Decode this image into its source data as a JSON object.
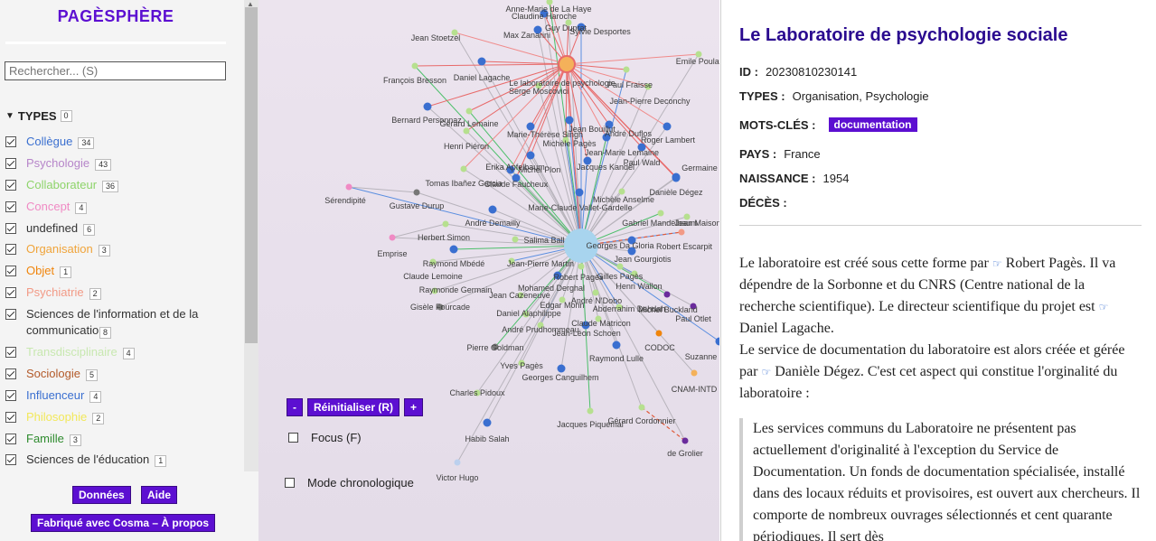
{
  "sidebar": {
    "title": "PAGÈSPHÈRE",
    "search_placeholder": "Rechercher... (S)",
    "types_heading": "TYPES",
    "types_count": "0",
    "types": [
      {
        "label": "Collègue",
        "count": "34",
        "color": "#3a6fd0"
      },
      {
        "label": "Psychologie",
        "count": "43",
        "color": "#b685c9"
      },
      {
        "label": "Collaborateur",
        "count": "36",
        "color": "#8ed46a"
      },
      {
        "label": "Concept",
        "count": "4",
        "color": "#f08ac4"
      },
      {
        "label": "undefined",
        "count": "6",
        "color": "#333333"
      },
      {
        "label": "Organisation",
        "count": "3",
        "color": "#f0a43a"
      },
      {
        "label": "Objet",
        "count": "1",
        "color": "#f0850c"
      },
      {
        "label": "Psychiatrie",
        "count": "2",
        "color": "#f29a86"
      },
      {
        "label": "Sciences de l'information et de la communication",
        "count": "8",
        "color": "#333333"
      },
      {
        "label": "Transdisciplinaire",
        "count": "4",
        "color": "#c8e8b0"
      },
      {
        "label": "Sociologie",
        "count": "5",
        "color": "#b35a2a"
      },
      {
        "label": "Influenceur",
        "count": "4",
        "color": "#3a6fd0"
      },
      {
        "label": "Philosophie",
        "count": "2",
        "color": "#f2e85a"
      },
      {
        "label": "Famille",
        "count": "3",
        "color": "#2e8b2e"
      },
      {
        "label": "Sciences de l'éducation",
        "count": "1",
        "color": "#333333"
      }
    ],
    "footer": {
      "data_button": "Données",
      "help_button": "Aide",
      "about_button": "Fabriqué avec Cosma – À propos"
    }
  },
  "graph": {
    "zoom_out": "-",
    "reset": "Réinitialiser (R)",
    "zoom_in": "+",
    "focus_label": "Focus (F)",
    "chrono_label": "Mode chronologique",
    "labels": [
      "Anne-Marie de La Haye",
      "Claudine Haroche",
      "Guy Duprat",
      "Jean Stoetzel",
      "Max Zanarini",
      "Sylvie Desportes",
      "Emile Poulat",
      "François Bresson",
      "Daniel Lagache",
      "Le laboratoire de psychologie",
      "Paul Fraisse",
      "Serge Moscovici",
      "Jean-Pierre Deconchy",
      "Bernard Personnaz",
      "Gérard Lemaine",
      "Jean Bouillut",
      "Marie-Thérèse Singh",
      "André Duflos",
      "Roger Lambert",
      "Henri Piéron",
      "Michèle Pagès",
      "Jean-Marie Lemaine",
      "Paul Wald",
      "Erika Apfelbaum",
      "Michel Plon",
      "Jacques Kandel",
      "Germaine",
      "Tomas Ibañez Garcia",
      "Claude Faucheux",
      "Danièle Dégez",
      "Sérendipité",
      "Gustave Durup",
      "Michèle Anselme",
      "Marie-Claude Vallet-Gardelle",
      "André Demailly",
      "Gabriel Mandelbaum",
      "Jean Maison",
      "Herbert Simon",
      "Salima Ball",
      "Georges Da Gloria",
      "Robert Escarpit",
      "Emprise",
      "Raymond Mbédé",
      "Jean Gourgiotis",
      "Claude Lemoine",
      "Jean-Pierre Martin",
      "Gilles Pagès",
      "Robert Pagès",
      "Raymonde Germain",
      "Mohamed Derghal",
      "Henri Wallon",
      "Jean Cazeneuve",
      "André N'Dobo",
      "Gisèle Fourcade",
      "Edgar Morin",
      "Abderrahim Dahdah",
      "Michel Buckland",
      "Daniel Alaphilippe",
      "Paul Otlet",
      "Claude Matricon",
      "André Prudhommeau",
      "Jean-Léon Schoen",
      "CODOC",
      "Pierre Goldman",
      "Raymond Lulle",
      "Suzanne Briet",
      "Yves Pagès",
      "Georges Canguilhem",
      "CNAM-INTD",
      "Charles Pidoux",
      "Jacques Piquemal",
      "Gérard Cordonnier",
      "Habib Salah",
      "de Grolier",
      "Victor Hugo"
    ]
  },
  "record": {
    "title": "Le Laboratoire de psychologie sociale",
    "id_label": "ID :",
    "id_value": "20230810230141",
    "types_label": "TYPES :",
    "types_value": "Organisation, Psychologie",
    "keywords_label": "MOTS-CLÉS :",
    "keyword": "documentation",
    "country_label": "PAYS :",
    "country_value": "France",
    "birth_label": "NAISSANCE :",
    "birth_value": "1954",
    "death_label": "DÉCÈS :",
    "death_value": "",
    "para1_a": "Le laboratoire est créé sous cette forme par ",
    "para1_link1": "Robert Pagès",
    "para1_b": ". Il va dépendre de la Sorbonne et du CNRS (Centre national de la recherche scientifique). Le directeur scientifique du projet est ",
    "para1_link2": "Daniel Lagache",
    "para1_c": ".",
    "para2_a": "Le service de documentation du laboratoire est alors créée et gérée par ",
    "para2_link": "Danièle Dégez",
    "para2_b": ". C'est cet aspect qui constitue l'orginalité du laboratoire :",
    "quote": "Les services communs du Laboratoire ne présentent pas actuellement d'originalité à l'exception du Service de Documentation. Un fonds de documentation spécialisée, installé dans des locaux réduits et provisoires, est ouvert aux chercheurs. Il comporte de nombreux ouvrages sélectionnés et cent quarante périodiques. Il sert dès"
  }
}
